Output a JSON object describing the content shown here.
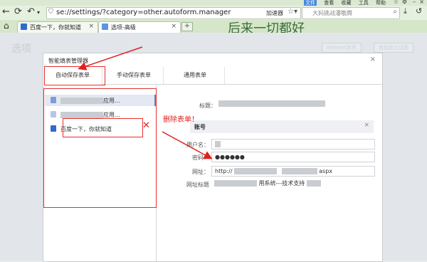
{
  "browser": {
    "menu": [
      "文件",
      "查看",
      "收藏",
      "工具",
      "帮助"
    ],
    "url": "se://settings/?category=other.autoform.manager",
    "accelerator": "加速器",
    "search_placeholder": "大妈挑战潘敬腾",
    "tabs": [
      {
        "label": "百度一下，你就知道"
      },
      {
        "label": "选项-高级"
      }
    ],
    "new_tab": "+",
    "slogan": "后来一切都好"
  },
  "page": {
    "title": "选项",
    "buttons": [
      "Internet选项",
      "恢复默认设置"
    ]
  },
  "dialog": {
    "title": "智能填表管理器",
    "close": "×",
    "tabs": [
      "自动保存表单",
      "手动保存表单",
      "通用表单"
    ],
    "list": [
      {
        "label": "应用..."
      },
      {
        "label": "应用..."
      },
      {
        "label": "百度一下，你就知道"
      }
    ],
    "form": {
      "title_label": "标题：",
      "account_header": "账号",
      "username_label": "用户名：",
      "password_label": "密码：",
      "password_value": "●●●●●●",
      "url_label": "网址：",
      "url_value_prefix": "http://",
      "url_value_suffix": "aspx",
      "url_title_label": "网址标题",
      "url_title_value": "用系统---技术支持"
    }
  },
  "annotation": {
    "delete_text": "删除表单！",
    "x_mark": "✕"
  },
  "colors": {
    "annotation": "#e02020",
    "accent": "#2f6bd1"
  }
}
